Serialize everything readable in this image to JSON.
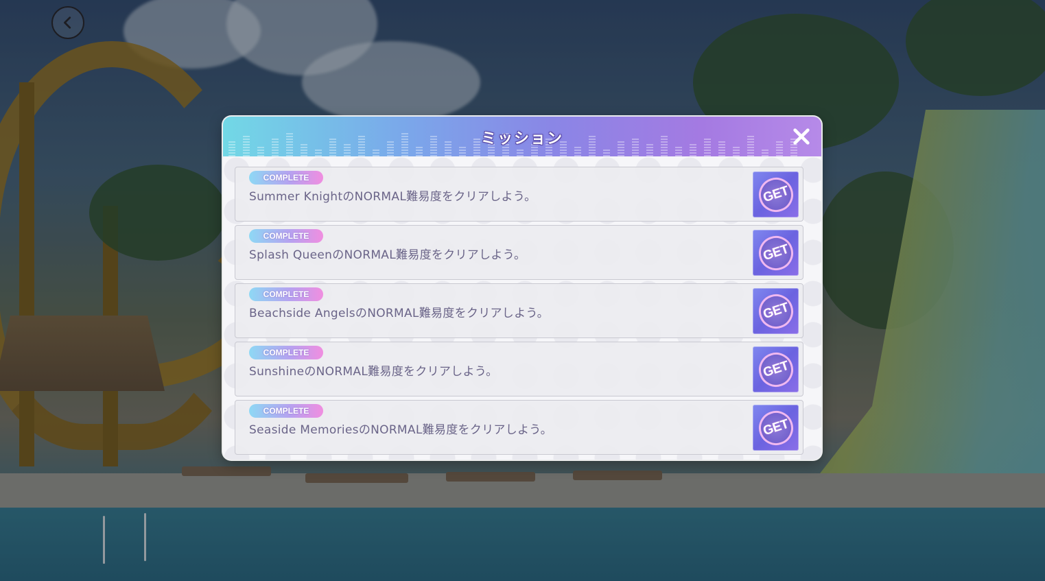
{
  "screen": {
    "back_icon": "chevron-left-icon"
  },
  "modal": {
    "title": "ミッション",
    "close_icon": "close-icon",
    "missions": [
      {
        "status": "COMPLETE",
        "text": "Summer KnightのNORMAL難易度をクリアしよう。",
        "button": "GET"
      },
      {
        "status": "COMPLETE",
        "text": "Splash QueenのNORMAL難易度をクリアしよう。",
        "button": "GET"
      },
      {
        "status": "COMPLETE",
        "text": "Beachside AngelsのNORMAL難易度をクリアしよう。",
        "button": "GET"
      },
      {
        "status": "COMPLETE",
        "text": "SunshineのNORMAL難易度をクリアしよう。",
        "button": "GET"
      },
      {
        "status": "COMPLETE",
        "text": "Seaside MemoriesのNORMAL難易度をクリアしよう。",
        "button": "GET"
      }
    ]
  },
  "colors": {
    "header_gradient_start": "#72d8e6",
    "header_gradient_end": "#b68ae8",
    "badge_start": "#8ed8f4",
    "badge_end": "#f08ee0",
    "get_button": "#6b63e0",
    "mission_text": "#6a6488"
  }
}
